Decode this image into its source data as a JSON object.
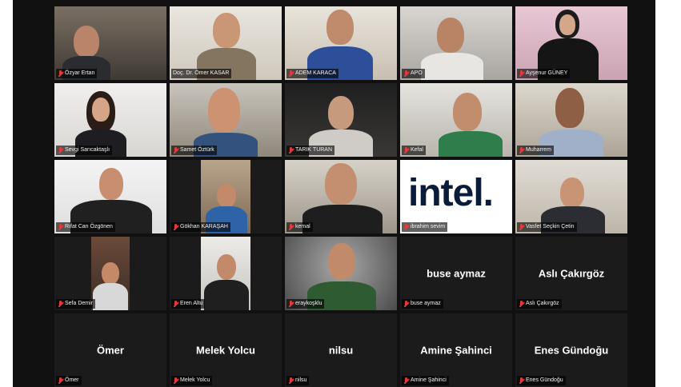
{
  "meeting": {
    "participants": [
      {
        "name": "Özyar Ertan",
        "video": true
      },
      {
        "name": "Doç. Dr. Ömer KASAR",
        "video": true,
        "active": true
      },
      {
        "name": "ADEM KARACA",
        "video": true
      },
      {
        "name": "APO",
        "video": true
      },
      {
        "name": "Ayşenur GÜNEY",
        "video": true
      },
      {
        "name": "Sevgi Sarıcaktaşlı",
        "video": true
      },
      {
        "name": "Samet Öztürk",
        "video": true
      },
      {
        "name": "TARIK TURAN",
        "video": true
      },
      {
        "name": "Kefal",
        "video": true
      },
      {
        "name": "Muharrem",
        "video": true
      },
      {
        "name": "Rıfat Can Özgönen",
        "video": true
      },
      {
        "name": "Gökhan KARAŞAH",
        "video": true
      },
      {
        "name": "kemal",
        "video": true
      },
      {
        "name": "ibrahim sevim",
        "video": true,
        "logo_text": "intel."
      },
      {
        "name": "Vasfet Seçkin Çetin",
        "video": true
      },
      {
        "name": "Sefa Demir",
        "video": true
      },
      {
        "name": "Eren Altu",
        "video": true
      },
      {
        "name": "eraykoşklu",
        "video": true
      },
      {
        "name": "buse aymaz",
        "video": false
      },
      {
        "name": "Aslı Çakırgöz",
        "video": false
      },
      {
        "name": "Ömer",
        "video": false
      },
      {
        "name": "Melek Yolcu",
        "video": false
      },
      {
        "name": "nilsu",
        "video": false
      },
      {
        "name": "Amine Şahinci",
        "video": false
      },
      {
        "name": "Enes Gündoğu",
        "video": false
      }
    ]
  },
  "colors": {
    "active_border": "#35c46b",
    "muted_mic": "#e23b3b",
    "frame_bg": "#111111"
  }
}
